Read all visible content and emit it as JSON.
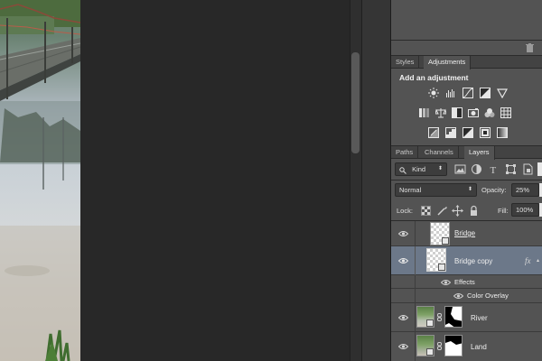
{
  "adjust_tabs": {
    "styles": "Styles",
    "adjustments": "Adjustments"
  },
  "adjustments": {
    "title": "Add an adjustment",
    "icons": [
      "brightness-contrast-icon",
      "levels-icon",
      "curves-icon",
      "exposure-icon",
      "vibrance-icon",
      "hue-saturation-icon",
      "color-balance-icon",
      "black-white-icon",
      "photo-filter-icon",
      "channel-mixer-icon",
      "color-lookup-icon",
      "invert-icon",
      "posterize-icon",
      "threshold-icon",
      "selective-color-icon",
      "gradient-map-icon"
    ]
  },
  "layers_tabs": {
    "paths": "Paths",
    "channels": "Channels",
    "layers": "Layers"
  },
  "filter": {
    "kind_label": "Kind",
    "icons": [
      "pixel-filter-icon",
      "adjustment-filter-icon",
      "type-filter-icon",
      "shape-filter-icon",
      "smart-object-filter-icon"
    ]
  },
  "blend": {
    "mode": "Normal",
    "opacity_label": "Opacity:",
    "opacity_value": "25%"
  },
  "lock": {
    "label": "Lock:",
    "fill_label": "Fill:",
    "fill_value": "100%"
  },
  "layers": [
    {
      "name": "Bridge",
      "selected": false
    },
    {
      "name": "Bridge copy",
      "selected": true,
      "fx": "fx"
    },
    {
      "name": "River",
      "selected": false
    },
    {
      "name": "Land",
      "selected": false
    }
  ],
  "effects": {
    "label": "Effects",
    "item": "Color Overlay"
  }
}
